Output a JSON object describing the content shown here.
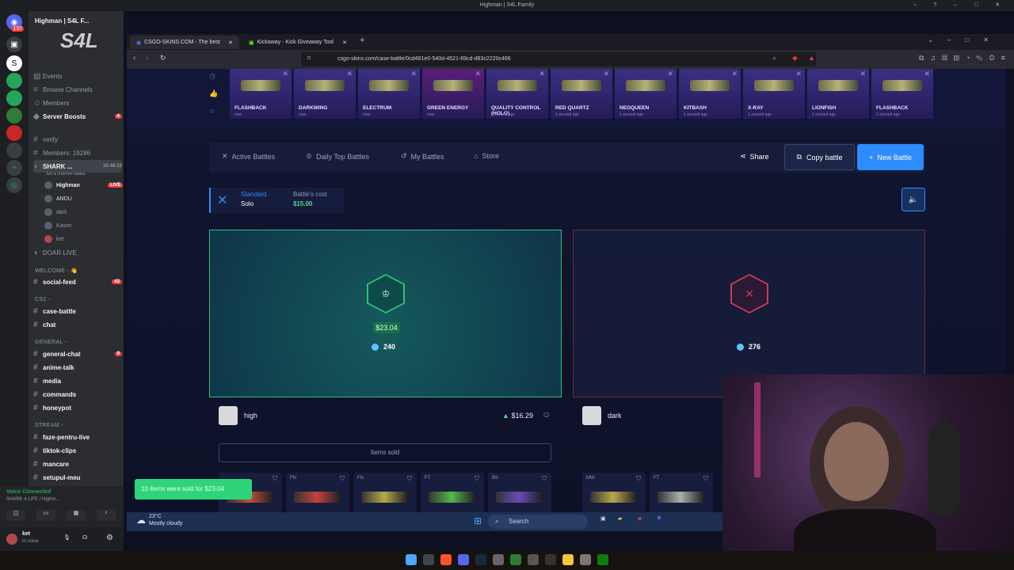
{
  "window": {
    "title": "Highman | S4L Family"
  },
  "discord": {
    "server_name": "Highman | S4L F...",
    "rail_badges": [
      "137"
    ],
    "menu": [
      "Events",
      "Browse Channels",
      "Members",
      "Server Boosts"
    ],
    "server_boosts_count": "4",
    "channels_top": [
      {
        "name": "verify"
      },
      {
        "name": "Members: 19286"
      }
    ],
    "voice_channel": {
      "name": "SHARK ...",
      "time": "10:46:23",
      "status": "Set a channel status"
    },
    "voice_users": [
      {
        "name": "Highman",
        "live": "LIVE"
      },
      {
        "name": "ANDU"
      },
      {
        "name": "dark"
      },
      {
        "name": "Kasim"
      },
      {
        "name": "ket"
      }
    ],
    "doar_live": "DOAR LIVE",
    "cat_welcome": "WELCOME - 👋",
    "social_feed": {
      "name": "social-feed",
      "count": "43"
    },
    "cat_cs2": "CS2 -",
    "case_battle": "case-battle",
    "chat": "chat",
    "cat_general": "GENERAL -",
    "general_chat": {
      "name": "general-chat",
      "count": "9"
    },
    "anime_talk": "anime-talk",
    "media": "media",
    "commands": "commands",
    "honeypot": "honeypot",
    "cat_stream": "STREAM -",
    "faze": "faze-pentru-live",
    "tiktok": "tiktok-clips",
    "mancare": "mancare",
    "setupul": "setupul-meu",
    "voice_connected": "Voice Connected",
    "voice_where": "SHARK 4 LIFE / Highm...",
    "me_name": "ket",
    "me_status": "In voice"
  },
  "browser": {
    "tabs": [
      {
        "label": "CSGO-SKINS.COM - The best"
      },
      {
        "label": "Kickaway - Kick Giveaway Tool"
      }
    ],
    "url": "csgo-skins.com/case-battle/0cd491e0-540d-4521-89cd-d83c2220c466"
  },
  "drops": [
    {
      "name": "FLASHBACK",
      "sub": "now",
      "color": "#3b2f82"
    },
    {
      "name": "DARKWING",
      "sub": "now",
      "color": "#3b2f82"
    },
    {
      "name": "ELECTRUM",
      "sub": "now",
      "color": "#3b2f82"
    },
    {
      "name": "GREEN ENERGY",
      "sub": "now",
      "color": "#5a1f7a"
    },
    {
      "name": "QUALITY CONTROL (HOLO)",
      "sub": "1 second ago",
      "color": "#3b2f82"
    },
    {
      "name": "RED QUARTZ",
      "sub": "1 second ago",
      "color": "#3b2f82"
    },
    {
      "name": "NEOQUEEN",
      "sub": "1 second ago",
      "color": "#3b2f82"
    },
    {
      "name": "KITBASH",
      "sub": "1 second ago",
      "color": "#3b2f82"
    },
    {
      "name": "X-RAY",
      "sub": "1 second ago",
      "color": "#3b2f82"
    },
    {
      "name": "LIONFISH",
      "sub": "1 second ago",
      "color": "#3b2f82"
    },
    {
      "name": "FLASHBACK",
      "sub": "1 second ago",
      "color": "#3b2f82"
    }
  ],
  "nav": {
    "active_battles": "Active Battles",
    "daily_top": "Daily Top Battles",
    "my_battles": "My Battles",
    "store": "Store",
    "share": "Share",
    "copy_battle": "Copy battle",
    "new_battle": "New Battle"
  },
  "battle": {
    "mode_line1": "Standard",
    "mode_line2": "Solo",
    "cost_label": "Battle's cost",
    "cost_value": "$15.00",
    "winner_total": "$23.04",
    "winner_coins": "240",
    "loser_coins": "276",
    "player1": {
      "name": "high",
      "value": "$16.29"
    },
    "player2": {
      "name": "dark"
    },
    "items_sold": "Items sold",
    "toast": "10 items were sold for $23.04"
  },
  "slots_left": [
    {
      "q": "",
      "color": "#c74a3a"
    },
    {
      "q": "FN",
      "color": "#c7413c"
    },
    {
      "q": "FN",
      "color": "#b8a84a"
    },
    {
      "q": "FT",
      "color": "#55b84a"
    },
    {
      "q": "BS",
      "color": "#6a4ab8"
    }
  ],
  "slots_right": [
    {
      "q": "MW",
      "color": "#b8a84a"
    },
    {
      "q": "FT",
      "color": "#a8b0a8"
    }
  ],
  "taskbar": {
    "weather_temp": "23°C",
    "weather_desc": "Mostly cloudy",
    "search": "Search"
  },
  "colors": {
    "accent": "#2f8cff",
    "win_green": "#2fbf78",
    "lose_red": "#c93c5a"
  }
}
